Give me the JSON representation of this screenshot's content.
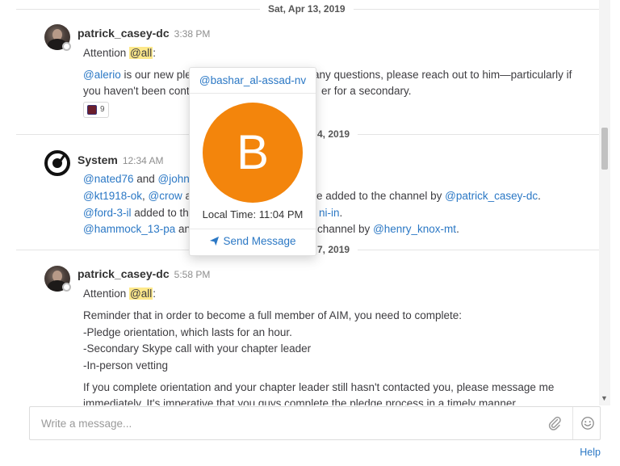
{
  "feed": {
    "dividers": [
      "Sat, Apr 13, 2019",
      "4, 2019",
      "7, 2019"
    ],
    "posts": [
      {
        "username": "patrick_casey-dc",
        "time": "3:38 PM",
        "attention_prefix": "Attention ",
        "attention_mention": "@all",
        "attention_suffix": ":",
        "line1_mention": "@alerio",
        "line1_text": " is our new ple",
        "line1_tail": "any questions, please reach out to him—particularly if",
        "line2_head": "you haven't been cont",
        "line2_tail": "er for a secondary.",
        "reaction_count": "9"
      },
      {
        "username": "System",
        "time": "12:34 AM",
        "line1_m1": "@nated76",
        "line1_and": " and ",
        "line1_m2": "@johnı",
        "line2_m1": "@kt1918-ok",
        "line2_comma": ", ",
        "line2_m2": "@crow",
        "line2_text": " a",
        "line2_tail_text": "ere added to the channel by ",
        "line2_tail_mention": "@patrick_casey-dc",
        "line2_tail_end": ".",
        "line3_m1": "@ford-3-il",
        "line3_text": " added to th",
        "line3_tail_mention": "ni-in",
        "line3_tail_end": ".",
        "line4_m1": "@hammock_13-pa",
        "line4_text": " an",
        "line4_tail_text": "channel by ",
        "line4_tail_mention": "@henry_knox-mt",
        "line4_tail_end": "."
      },
      {
        "username": "patrick_casey-dc",
        "time": "5:58 PM",
        "attention_prefix": "Attention ",
        "attention_mention": "@all",
        "attention_suffix": ":",
        "lines": [
          "Reminder that in order to become a full member of AIM, you need to complete:",
          "-Pledge orientation, which lasts for an hour.",
          "-Secondary Skype call with your chapter leader",
          "-In-person vetting",
          "If you complete orientation and your chapter leader still hasn't contacted you, please message me",
          "immediately. It's imperative that you guys complete the pledge process in a timely manner."
        ]
      }
    ]
  },
  "popover": {
    "username": "@bashar_al-assad-nv",
    "avatar_letter": "B",
    "avatar_color": "#f3850c",
    "local_time": "Local Time: 11:04 PM",
    "send_label": "Send Message"
  },
  "composer": {
    "placeholder": "Write a message..."
  },
  "footer": {
    "help_label": "Help"
  },
  "colors": {
    "link": "#2b78c5",
    "mention_highlight": "#fde88a"
  }
}
